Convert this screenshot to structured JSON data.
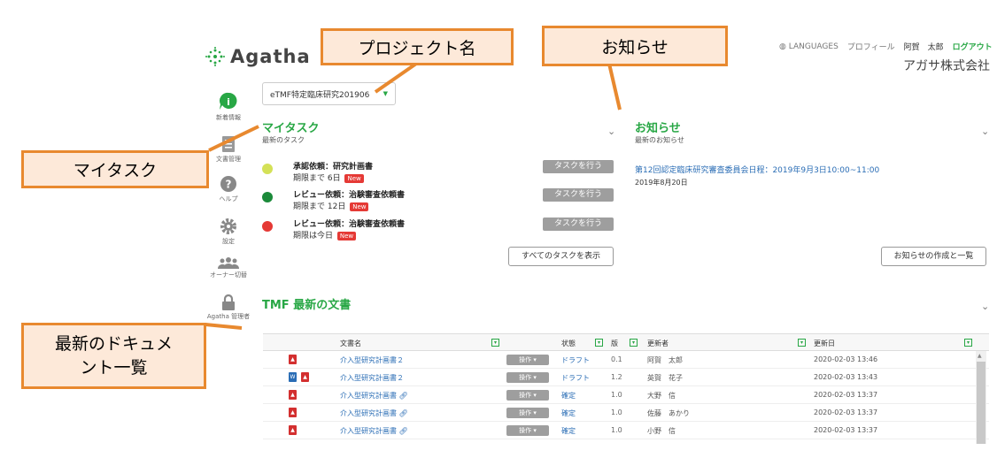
{
  "logo": {
    "text": "Agatha"
  },
  "header": {
    "languages": "LANGUAGES",
    "profile": "プロフィール",
    "user": "阿賀　太郎",
    "logout": "ログアウト",
    "company": "アガサ株式会社"
  },
  "project": {
    "selected": "eTMF特定臨床研究201906"
  },
  "sidebar": {
    "items": [
      {
        "label": "新着情報"
      },
      {
        "label": "文書管理"
      },
      {
        "label": "ヘルプ"
      },
      {
        "label": "設定"
      },
      {
        "label": "オーナー切替"
      },
      {
        "label": "Agatha 管理者"
      }
    ]
  },
  "callouts": {
    "project_name": "プロジェクト名",
    "notices": "お知らせ",
    "my_tasks": "マイタスク",
    "latest_docs": "最新のドキュメ\nント一覧"
  },
  "mytask": {
    "title": "マイタスク",
    "subtitle": "最新のタスク",
    "items": [
      {
        "title": "承認依頼：研究計画書",
        "due": "期限まで 6日",
        "new": "New",
        "button": "タスクを行う",
        "color": "#d4e157"
      },
      {
        "title": "レビュー依頼：治験審査依頼書",
        "due": "期限まで 12日",
        "new": "New",
        "button": "タスクを行う",
        "color": "#1b8a3a"
      },
      {
        "title": "レビュー依頼：治験審査依頼書",
        "due": "期限は今日",
        "new": "New",
        "button": "タスクを行う",
        "color": "#e53935"
      }
    ],
    "show_all": "すべてのタスクを表示"
  },
  "notices": {
    "title": "お知らせ",
    "subtitle": "最新のお知らせ",
    "item_title": "第12回認定臨床研究審査委員会日程：2019年9月3日10:00~11:00",
    "item_date": "2019年8月20日",
    "create_button": "お知らせの作成と一覧"
  },
  "tmf": {
    "title": "TMF 最新の文書",
    "columns": {
      "name": "文書名",
      "status": "状態",
      "version": "版",
      "updater": "更新者",
      "updated": "更新日"
    },
    "op_label": "操作",
    "rows": [
      {
        "name": "介入型研究計画書２",
        "status": "ドラフト",
        "version": "0.1",
        "updater": "阿賀　太郎",
        "updated": "2020-02-03 13:46"
      },
      {
        "name": "介入型研究計画書２",
        "status": "ドラフト",
        "version": "1.2",
        "updater": "英賀　花子",
        "updated": "2020-02-03 13:43"
      },
      {
        "name": "介入型研究計画書",
        "status": "確定",
        "version": "1.0",
        "updater": "大野　信",
        "updated": "2020-02-03 13:37"
      },
      {
        "name": "介入型研究計画書",
        "status": "確定",
        "version": "1.0",
        "updater": "佐藤　あかり",
        "updated": "2020-02-03 13:37"
      },
      {
        "name": "介入型研究計画書",
        "status": "確定",
        "version": "1.0",
        "updater": "小野　信",
        "updated": "2020-02-03 13:37"
      }
    ]
  }
}
